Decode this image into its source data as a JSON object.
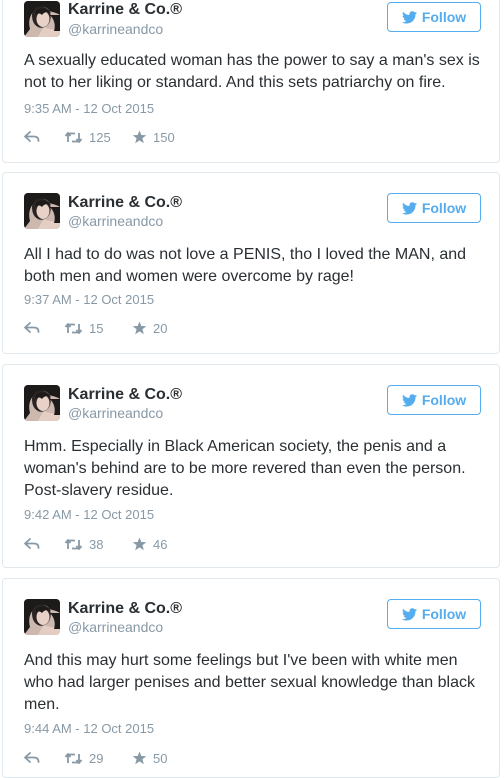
{
  "colors": {
    "accent": "#55acee",
    "name_text": "#292f33",
    "muted_text": "#8899a6",
    "border": "#e1e8ed"
  },
  "icons": {
    "follow": "twitter-bird-icon",
    "reply": "reply-icon",
    "retweet": "retweet-icon",
    "favorite": "star-icon"
  },
  "tweets": [
    {
      "name": "Karrine & Co.®",
      "handle": "@karrineandco",
      "follow_label": "Follow",
      "text": "A sexually educated woman has the power to say a man's sex is not to her liking or standard. And this sets patriarchy on fire.",
      "timestamp": "9:35 AM - 12 Oct 2015",
      "retweets": "125",
      "favorites": "150"
    },
    {
      "name": "Karrine & Co.®",
      "handle": "@karrineandco",
      "follow_label": "Follow",
      "text": "All I had to do was not love a PENIS, tho I loved the MAN, and both men and women were overcome by rage!",
      "timestamp": "9:37 AM - 12 Oct 2015",
      "retweets": "15",
      "favorites": "20"
    },
    {
      "name": "Karrine & Co.®",
      "handle": "@karrineandco",
      "follow_label": "Follow",
      "text": "Hmm. Especially in Black American society, the penis and a woman's behind are to be more revered than even the person. Post-slavery residue.",
      "timestamp": "9:42 AM - 12 Oct 2015",
      "retweets": "38",
      "favorites": "46"
    },
    {
      "name": "Karrine & Co.®",
      "handle": "@karrineandco",
      "follow_label": "Follow",
      "text": "And this may hurt some feelings but I've been with white men who had larger penises and better sexual knowledge than black men.",
      "timestamp": "9:44 AM - 12 Oct 2015",
      "retweets": "29",
      "favorites": "50"
    }
  ]
}
